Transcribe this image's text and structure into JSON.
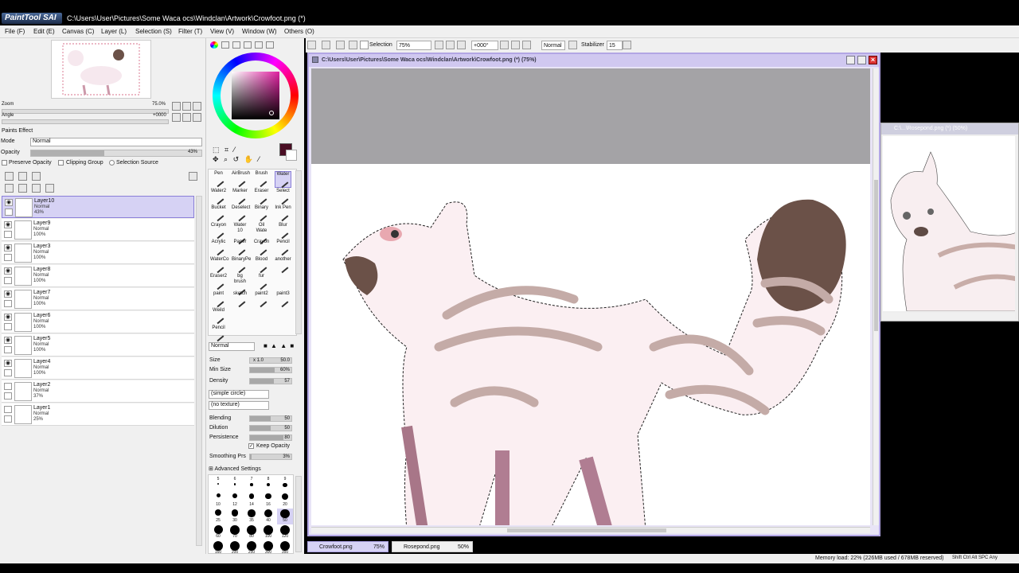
{
  "window": {
    "title_path": "C:\\Users\\User\\Pictures\\Some Waca ocs\\Windclan\\Artwork\\Crowfoot.png (*)",
    "app_logo": "PaintTool SAI"
  },
  "menu": [
    "File (F)",
    "Edit (E)",
    "Canvas (C)",
    "Layer (L)",
    "Selection (S)",
    "Filter (T)",
    "View (V)",
    "Window (W)",
    "Others (O)"
  ],
  "toolbar": {
    "selection_label": "Selection",
    "zoom": "75%",
    "angle": "+000°",
    "blend_mode": "Normal",
    "stabilizer_label": "Stabilizer",
    "stabilizer_value": "15"
  },
  "navigator": {
    "zoom_label": "Zoom",
    "zoom_value": "75.0%",
    "angle_label": "Angle",
    "angle_value": "+0000"
  },
  "layer_props": {
    "section": "Paints Effect",
    "mode_label": "Mode",
    "mode_value": "Normal",
    "opacity_label": "Opacity",
    "opacity_value": "43%",
    "opacity_fraction": 0.43,
    "preserve_opacity": "Preserve Opacity",
    "clipping_group": "Clipping Group",
    "selection_source": "Selection Source"
  },
  "layers": [
    {
      "name": "Layer10",
      "mode": "Normal",
      "opacity": "43%"
    },
    {
      "name": "Layer9",
      "mode": "Normal",
      "opacity": "100%"
    },
    {
      "name": "Layer3",
      "mode": "Normal",
      "opacity": "100%"
    },
    {
      "name": "Layer8",
      "mode": "Normal",
      "opacity": "100%"
    },
    {
      "name": "Layer7",
      "mode": "Normal",
      "opacity": "100%"
    },
    {
      "name": "Layer6",
      "mode": "Normal",
      "opacity": "100%"
    },
    {
      "name": "Layer5",
      "mode": "Normal",
      "opacity": "100%"
    },
    {
      "name": "Layer4",
      "mode": "Normal",
      "opacity": "100%"
    },
    {
      "name": "Layer2",
      "mode": "Normal",
      "opacity": "37%"
    },
    {
      "name": "Layer1",
      "mode": "Normal",
      "opacity": "25%"
    }
  ],
  "tools": [
    "Pen",
    "AirBrush",
    "Brush",
    "Water",
    "Water2",
    "Marker",
    "Eraser",
    "Select",
    "Bucket",
    "Deselect",
    "Binary",
    "Ink Pen",
    "Crayon",
    "Water 10",
    "Oil Wate",
    "Blur",
    "Acrylic",
    "Paper",
    "Crayon",
    "Pencil",
    "WaterCo",
    "BinaryPe",
    "Blood",
    "another",
    "Eraser2",
    "bg brush",
    "fur",
    "",
    "paint",
    "sketch",
    "paint2",
    "paint3",
    "Weild",
    "",
    "",
    "",
    "Pencil",
    "",
    "",
    ""
  ],
  "brush": {
    "mode": "Normal",
    "size_label": "Size",
    "size_mult": "x 1.0",
    "size_value": "50.0",
    "min_size_label": "Min Size",
    "min_size_value": "60%",
    "density_label": "Density",
    "density_value": "57",
    "shape": "(simple circle)",
    "texture": "(no texture)",
    "blending_label": "Blending",
    "blending_value": "50",
    "dilution_label": "Dilution",
    "dilution_value": "50",
    "persistence_label": "Persistence",
    "persistence_value": "80",
    "keep_opacity": "Keep Opacity",
    "smoothing_label": "Smoothing Prs",
    "smoothing_value": "3%",
    "advanced": "Advanced Settings"
  },
  "brush_sizes": [
    "5",
    "6",
    "7",
    "8",
    "9",
    "10",
    "12",
    "14",
    "16",
    "20",
    "25",
    "30",
    "35",
    "40",
    "50",
    "60",
    "70",
    "80",
    "100",
    "120",
    "160",
    "200",
    "250",
    "300",
    "350"
  ],
  "canvas_title": "C:\\Users\\User\\Pictures\\Some Waca ocs\\Windclan\\Artwork\\Crowfoot.png (*) (75%)",
  "second_window_title": "C:\\...\\Rosepond.png (*) (50%)",
  "tabs": [
    {
      "name": "Crowfoot.png",
      "zoom": "75%"
    },
    {
      "name": "Rosepond.png",
      "zoom": "50%"
    }
  ],
  "status": {
    "memory": "Memory load: 22% (226MB used / 678MB reserved)",
    "keys": "Shift Ctrl Alt SPC Any"
  },
  "colors": {
    "current_color": "#4a0e24",
    "selection_border": "#b2a6e4",
    "layer_selected": "#d6d2f4"
  }
}
